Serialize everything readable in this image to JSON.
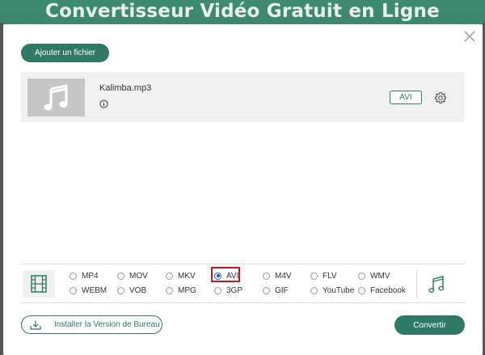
{
  "page": {
    "title": "Convertisseur Vidéo Gratuit en Ligne"
  },
  "toolbar": {
    "add_file_label": "Ajouter un fichier"
  },
  "file": {
    "name": "Kalimba.mp3",
    "format": "AVI"
  },
  "formats": {
    "selected": "AVI",
    "row1": [
      "MP4",
      "MOV",
      "MKV",
      "AVI",
      "M4V",
      "FLV",
      "WMV"
    ],
    "row2": [
      "WEBM",
      "VOB",
      "MPG",
      "3GP",
      "GIF",
      "YouTube",
      "Facebook"
    ]
  },
  "footer": {
    "install_label": "Installer la Version de Bureau",
    "convert_label": "Convertir"
  },
  "colors": {
    "accent": "#2f7a66",
    "highlight": "#d0161d",
    "radio_selected": "#1f5fb0"
  },
  "icons": {
    "close": "close-icon",
    "music": "music-note-icon",
    "info": "info-icon",
    "settings": "gear-icon",
    "video": "film-icon",
    "audio": "music-note-icon",
    "download": "download-icon"
  }
}
